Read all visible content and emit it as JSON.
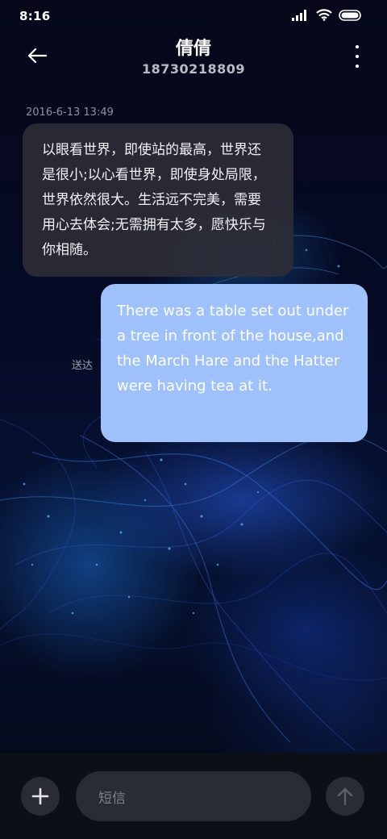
{
  "status_bar": {
    "time": "8:16",
    "icons": [
      "signal-icon",
      "wifi-icon",
      "battery-icon"
    ]
  },
  "header": {
    "contact_name": "倩倩",
    "contact_number": "18730218809",
    "back_icon": "back-arrow-icon",
    "more_icon": "more-vertical-icon"
  },
  "messages": [
    {
      "direction": "incoming",
      "timestamp": "2016-6-13 13:49",
      "text": "以眼看世界，即使站的最高，世界还是很小;以心看世界，即使身处局限，世界依然很大。生活远不完美，需要用心去体会;无需拥有太多，愿快乐与你相随。"
    },
    {
      "direction": "outgoing",
      "status": "送达",
      "text": "There was a table set out under a tree in front of the house,and the March Hare and the Hatter were having tea at it."
    }
  ],
  "composer": {
    "placeholder": "短信",
    "add_icon": "plus-icon",
    "send_icon": "send-arrow-icon"
  },
  "colors": {
    "incoming_bubble": "#2c2d36",
    "outgoing_bubble": "#9ec1fc",
    "background": "#050a24",
    "input_bar": "#0d0f17"
  }
}
